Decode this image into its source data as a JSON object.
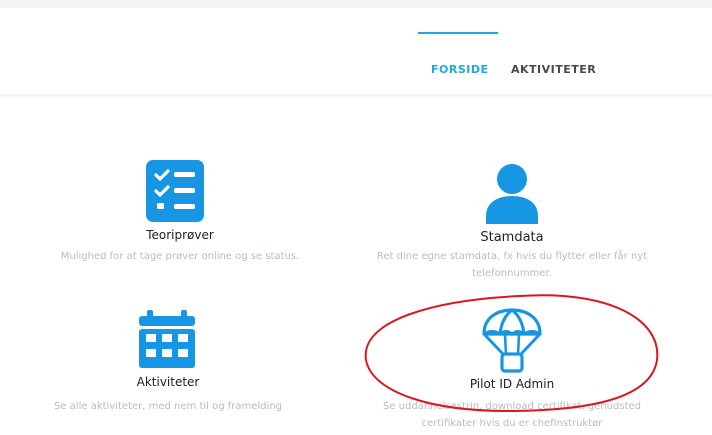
{
  "colors": {
    "accent": "#1ea7e1",
    "icon": "#1796e4",
    "annotation": "#d7191f"
  },
  "nav": {
    "forside": "FORSIDE",
    "aktiviteter": "AKTIVITETER"
  },
  "cards": {
    "teori": {
      "icon": "checklist-icon",
      "title": "Teoriprøver",
      "description": "Mulighed for at tage prøver online og se status."
    },
    "stamdata": {
      "icon": "person-icon",
      "title": "Stamdata",
      "description": "Ret dine egne stamdata, fx hvis du flytter eller får nyt telefonnummer."
    },
    "aktiviteter": {
      "icon": "calendar-icon",
      "title": "Aktiviteter",
      "description": "Se alle aktiviteter, med nem til og framelding"
    },
    "pilot": {
      "icon": "parachute-icon",
      "title": "Pilot ID Admin",
      "description": "Se uddannelsestrin, download certifikat, genudsted certifikater hvis du er chefinstruktør"
    }
  }
}
